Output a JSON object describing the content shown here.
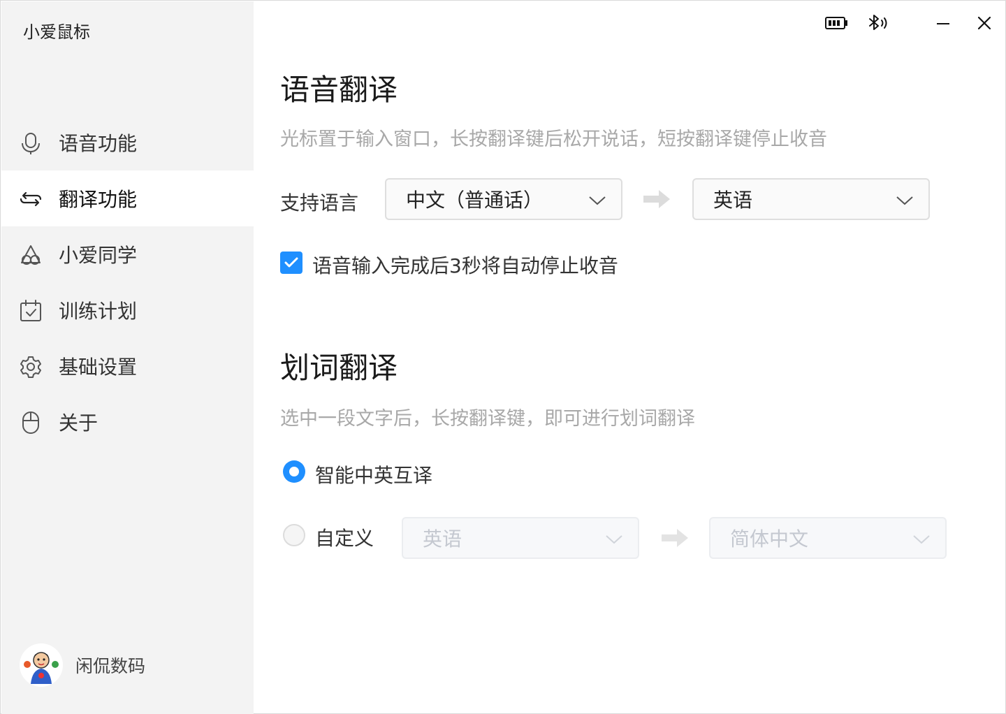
{
  "app": {
    "title": "小爱鼠标"
  },
  "sidebar": {
    "items": [
      {
        "label": "语音功能",
        "icon": "microphone-icon",
        "active": false
      },
      {
        "label": "翻译功能",
        "icon": "translate-loop-icon",
        "active": true
      },
      {
        "label": "小爱同学",
        "icon": "xiaoai-icon",
        "active": false
      },
      {
        "label": "训练计划",
        "icon": "calendar-check-icon",
        "active": false
      },
      {
        "label": "基础设置",
        "icon": "gear-icon",
        "active": false
      },
      {
        "label": "关于",
        "icon": "mouse-icon",
        "active": false
      }
    ],
    "user": {
      "name": "闲侃数码",
      "avatar": "avatar"
    }
  },
  "titlebar": {
    "battery_icon": "battery-icon",
    "bluetooth_icon": "bluetooth-icon",
    "minimize_icon": "minimize-icon",
    "close_icon": "close-icon"
  },
  "voice_translation": {
    "title": "语音翻译",
    "description": "光标置于输入窗口，长按翻译键后松开说话，短按翻译键停止收音",
    "language_label": "支持语言",
    "source_language": "中文（普通话）",
    "target_language": "英语",
    "auto_stop_label": "语音输入完成后3秒将自动停止收音",
    "auto_stop_checked": true
  },
  "word_translation": {
    "title": "划词翻译",
    "description": "选中一段文字后，长按翻译键，即可进行划词翻译",
    "smart_option_label": "智能中英互译",
    "smart_selected": true,
    "custom_option_label": "自定义",
    "custom_source": "英语",
    "custom_target": "简体中文"
  },
  "colors": {
    "accent": "#1f8fff",
    "sidebar_bg": "#f3f3f3",
    "muted_text": "#a8a8a8"
  }
}
